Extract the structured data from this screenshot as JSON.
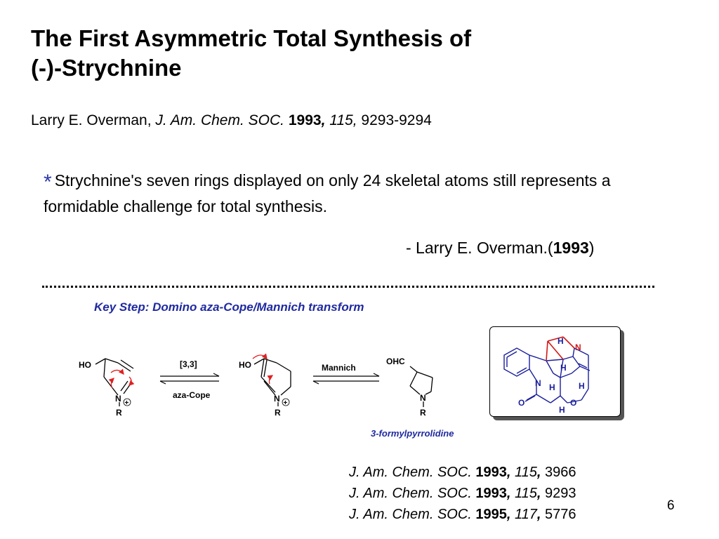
{
  "title": {
    "line1": "The First Asymmetric Total Synthesis of",
    "line2": "(-)-Strychnine"
  },
  "citation": {
    "author": "Larry E. Overman,",
    "journal": "J. Am. Chem. SOC.",
    "year": "1993",
    "volume": "115",
    "pages": "9293-9294"
  },
  "quote": {
    "bullet": "*",
    "text": "Strychnine's seven rings displayed on only 24 skeletal atoms still represents a formidable challenge for total synthesis.",
    "attribution_prefix": "- Larry E. Overman.(",
    "attribution_year": "1993",
    "attribution_suffix": ")"
  },
  "key_step": "Key Step: Domino aza-Cope/Mannich transform",
  "scheme": {
    "arrow1_top": "[3,3]",
    "arrow1_bottom": "aza-Cope",
    "arrow2_top": "Mannich",
    "ho_label": "HO",
    "ohc_label": "OHC",
    "n_label": "N",
    "r_label": "R",
    "plus": "+",
    "product_label": "3-formylpyrrolidine"
  },
  "strychnine": {
    "n_label": "N",
    "o_label": "O",
    "h_label": "H"
  },
  "references": [
    {
      "journal": "J. Am. Chem. SOC.",
      "year": "1993",
      "volume": "115",
      "pages": "3966"
    },
    {
      "journal": "J. Am. Chem. SOC.",
      "year": "1993",
      "volume": "115",
      "pages": "9293"
    },
    {
      "journal": "J. Am. Chem. SOC.",
      "year": "1995",
      "volume": "117",
      "pages": "5776"
    }
  ],
  "page_number": "6",
  "colors": {
    "accent_blue": "#1f2aa0",
    "bond_blue": "#1a1f9c",
    "highlight_red": "#d01818",
    "arrow_red": "#e02020"
  }
}
